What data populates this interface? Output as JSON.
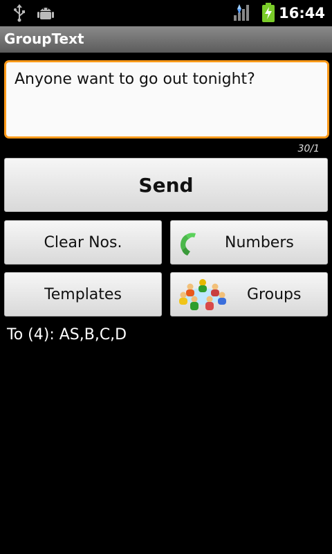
{
  "status_bar": {
    "time": "16:44",
    "icons": [
      "usb-icon",
      "android-debug-icon",
      "signal-icon",
      "battery-charging-icon"
    ]
  },
  "app": {
    "title": "GroupText"
  },
  "message": {
    "text": "Anyone want to go out tonight?",
    "counter": "30/1"
  },
  "buttons": {
    "send": "Send",
    "clear": "Clear Nos.",
    "numbers": "Numbers",
    "templates": "Templates",
    "groups": "Groups"
  },
  "recipients": {
    "label": "To (4):  AS,B,C,D"
  },
  "colors": {
    "focus_border": "#ff9a1a",
    "title_bar": "#6e6e6e"
  }
}
